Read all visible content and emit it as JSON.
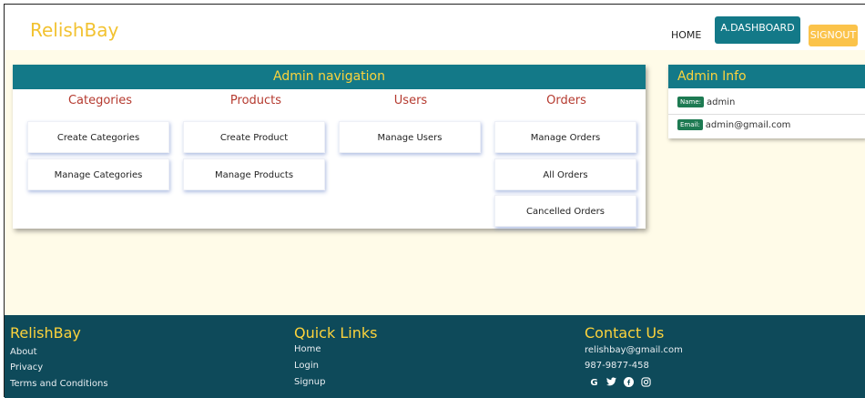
{
  "navbar": {
    "brand": "RelishBay",
    "home": "HOME",
    "dashboard": "A.DASHBOARD",
    "signout": "SIGNOUT"
  },
  "admin_nav": {
    "title": "Admin navigation",
    "columns": [
      {
        "title": "Categories",
        "items": [
          "Create Categories",
          "Manage Categories"
        ]
      },
      {
        "title": "Products",
        "items": [
          "Create Product",
          "Manage Products"
        ]
      },
      {
        "title": "Users",
        "items": [
          "Manage Users"
        ]
      },
      {
        "title": "Orders",
        "items": [
          "Manage Orders",
          "All Orders",
          "Cancelled Orders"
        ]
      }
    ]
  },
  "admin_info": {
    "title": "Admin Info",
    "name_label": "Name:",
    "name_value": "admin",
    "email_label": "Email:",
    "email_value": "admin@gmail.com"
  },
  "footer": {
    "brand": "RelishBay",
    "about": "About",
    "privacy": "Privacy",
    "terms": "Terms and Conditions",
    "quick_links_title": "Quick Links",
    "links": [
      "Home",
      "Login",
      "Signup"
    ],
    "contact_title": "Contact Us",
    "email": "relishbay@gmail.com",
    "phone": "987-9877-458",
    "social_icons": [
      "google-icon",
      "twitter-icon",
      "facebook-icon",
      "instagram-icon"
    ]
  },
  "colors": {
    "teal": "#137988",
    "yellow": "#fcd33c",
    "footer": "#0e4a5a",
    "content_bg": "#fffbe8"
  }
}
